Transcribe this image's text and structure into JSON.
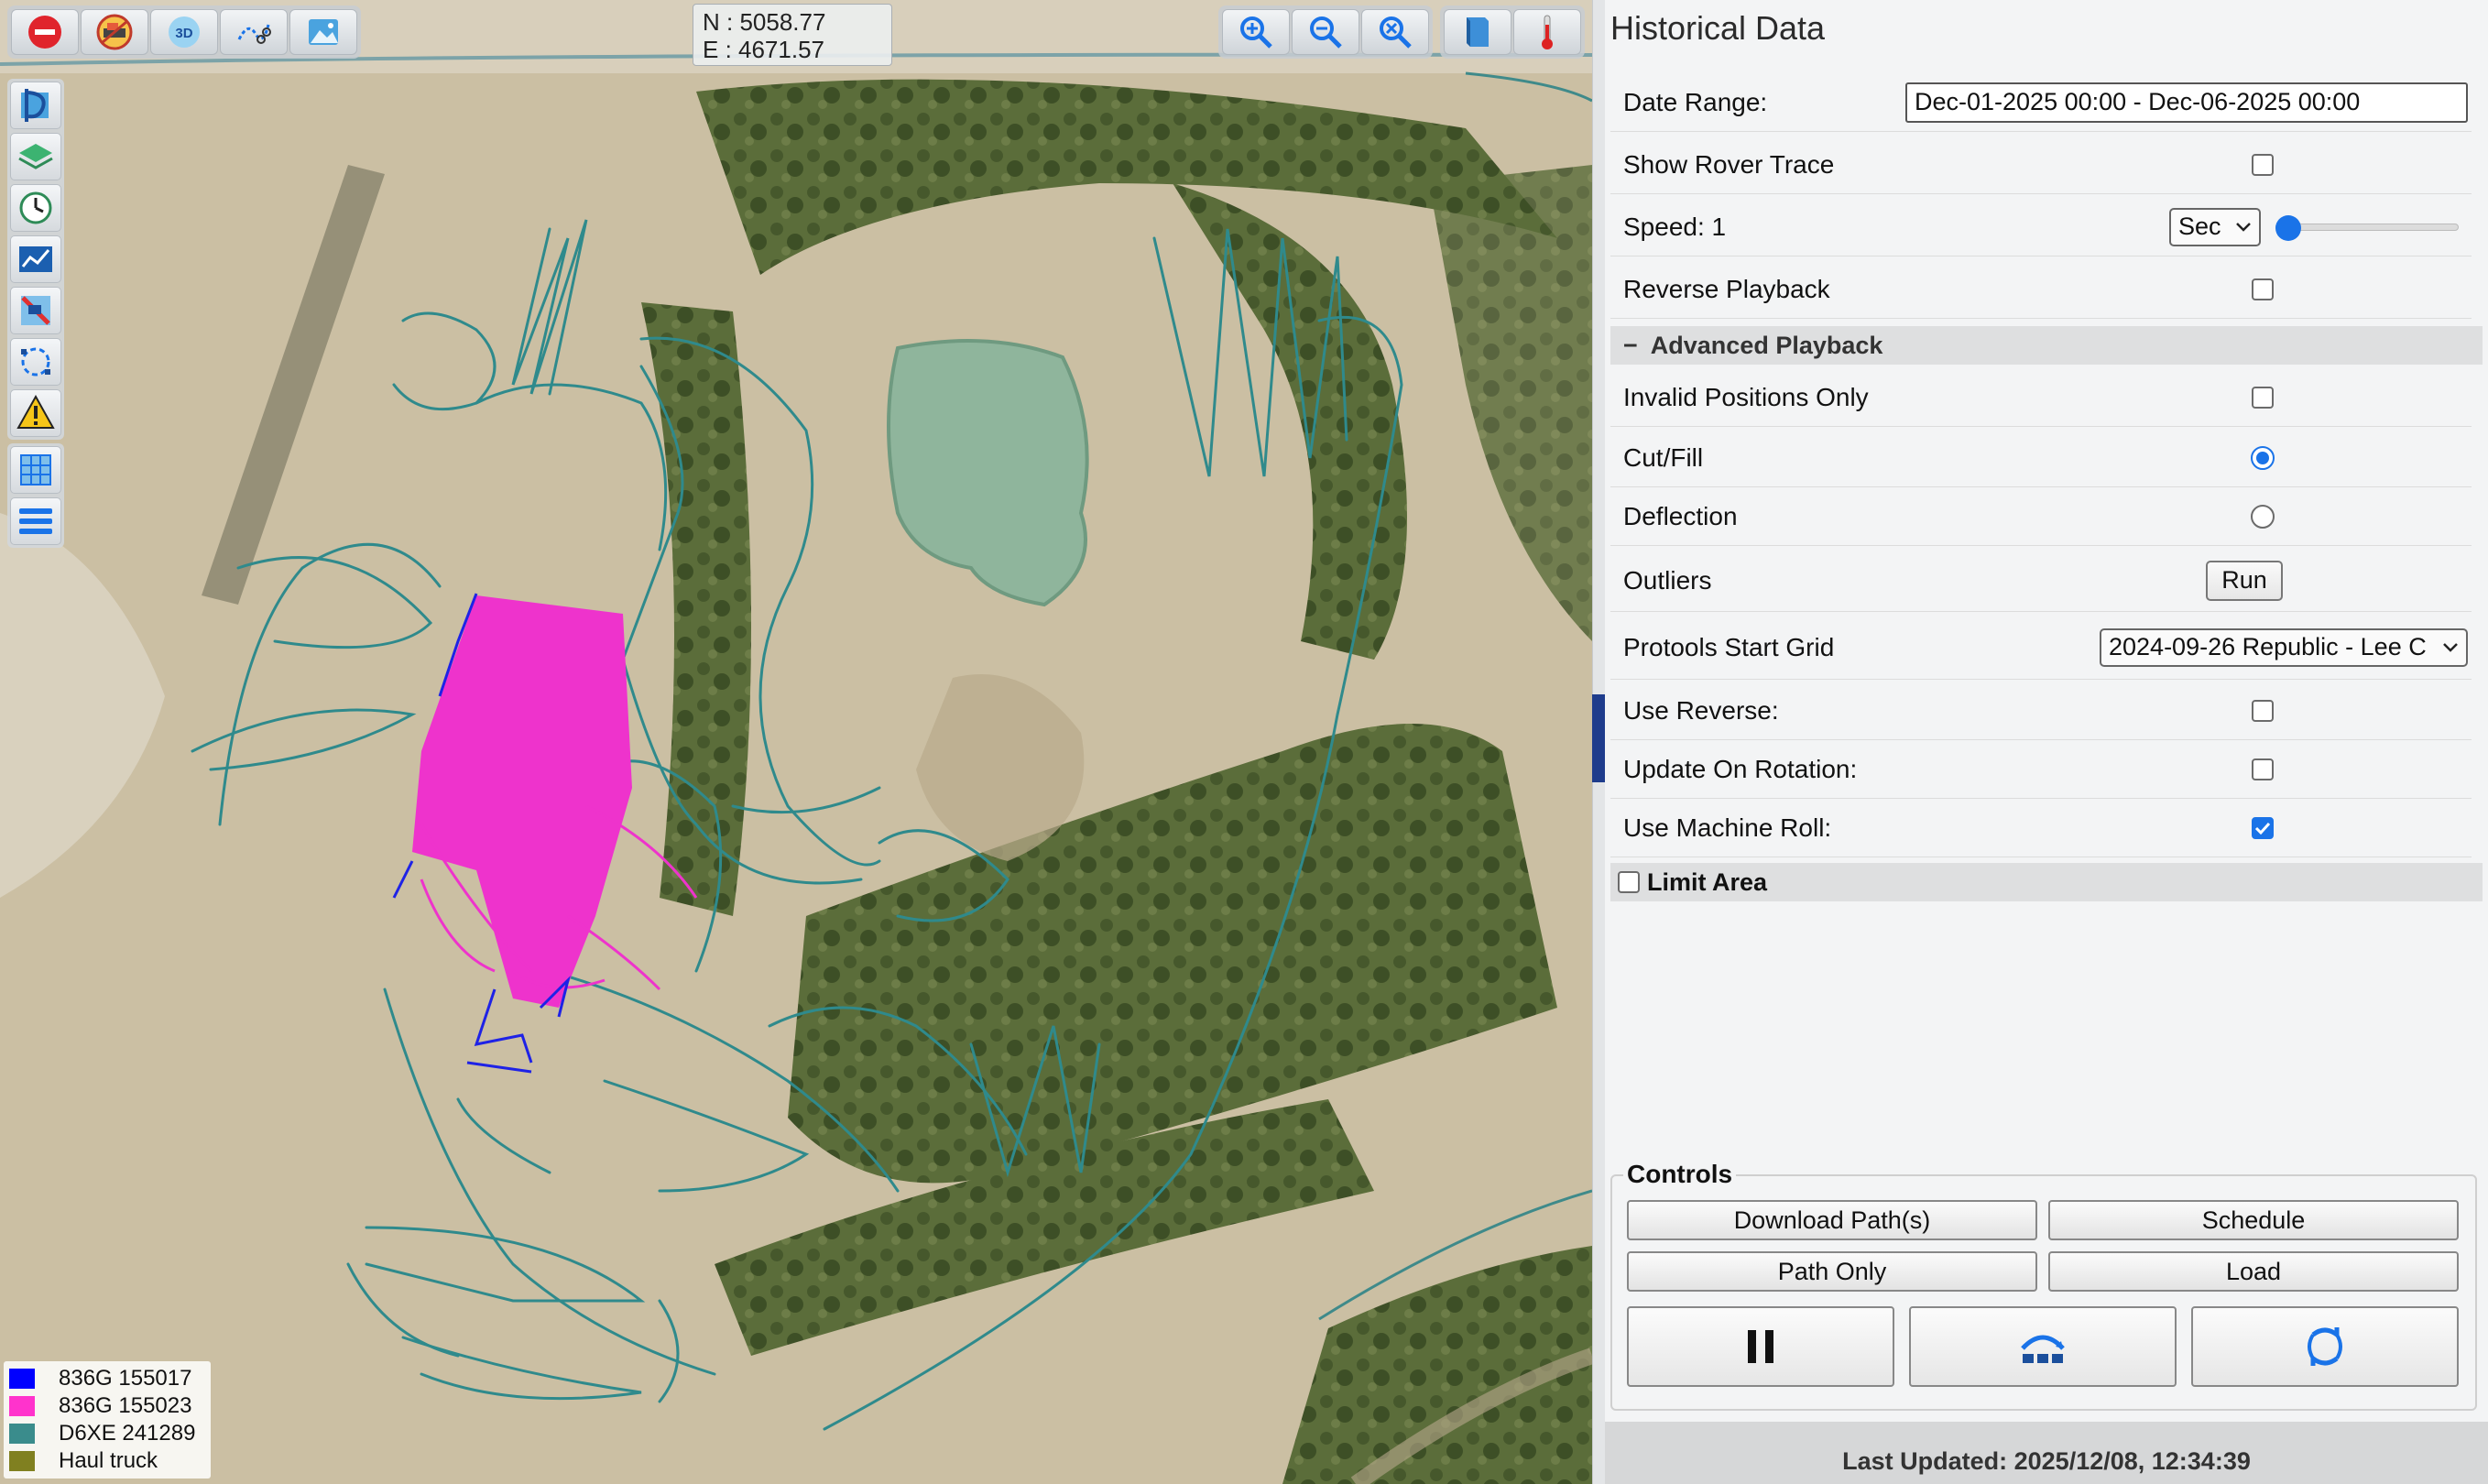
{
  "toolbar": {
    "left": [
      "stop-icon",
      "machine-icon",
      "3d-view-icon",
      "path-cut-icon",
      "image-icon"
    ],
    "threed_label": "3D",
    "right": [
      "zoom-in-icon",
      "zoom-out-icon",
      "zoom-extent-icon",
      "book-icon",
      "thermometer-icon"
    ]
  },
  "coords": {
    "north": "N : 5058.77",
    "east": "E : 4671.57"
  },
  "left_tools": [
    "design-icon",
    "layers-icon",
    "history-icon",
    "chart-icon",
    "machine-select-icon",
    "boundary-icon",
    "warning-icon",
    "grid-icon",
    "list-icon"
  ],
  "legend": [
    {
      "label": "836G 155017",
      "color": "#0000ff"
    },
    {
      "label": "836G 155023",
      "color": "#ff33cc"
    },
    {
      "label": "D6XE 241289",
      "color": "#3a8c8c"
    },
    {
      "label": "Haul truck",
      "color": "#808020"
    }
  ],
  "panel": {
    "title": "Historical Data",
    "date_range_label": "Date Range:",
    "date_range_value": "Dec-01-2025 00:00 - Dec-06-2025 00:00",
    "show_rover_trace_label": "Show Rover Trace",
    "show_rover_trace": false,
    "speed_label": "Speed: 1",
    "speed_unit": "Sec",
    "speed_slider": 0,
    "reverse_playback_label": "Reverse Playback",
    "reverse_playback": false,
    "advanced_header": "Advanced Playback",
    "advanced_toggle": "−",
    "invalid_positions_label": "Invalid Positions Only",
    "invalid_positions": false,
    "cut_fill_label": "Cut/Fill",
    "cut_fill": true,
    "deflection_label": "Deflection",
    "deflection": false,
    "outliers_label": "Outliers",
    "run_label": "Run",
    "start_grid_label": "Protools Start Grid",
    "start_grid_value": "2024-09-26 Republic - Lee C",
    "use_reverse_label": "Use Reverse:",
    "use_reverse": false,
    "update_rotation_label": "Update On Rotation:",
    "update_rotation": false,
    "machine_roll_label": "Use Machine Roll:",
    "machine_roll": true,
    "limit_area_label": "Limit Area",
    "limit_area": false,
    "controls_label": "Controls",
    "download_label": "Download Path(s)",
    "schedule_label": "Schedule",
    "path_only_label": "Path Only",
    "load_label": "Load",
    "last_updated": "Last Updated: 2025/12/08, 12:34:39"
  }
}
